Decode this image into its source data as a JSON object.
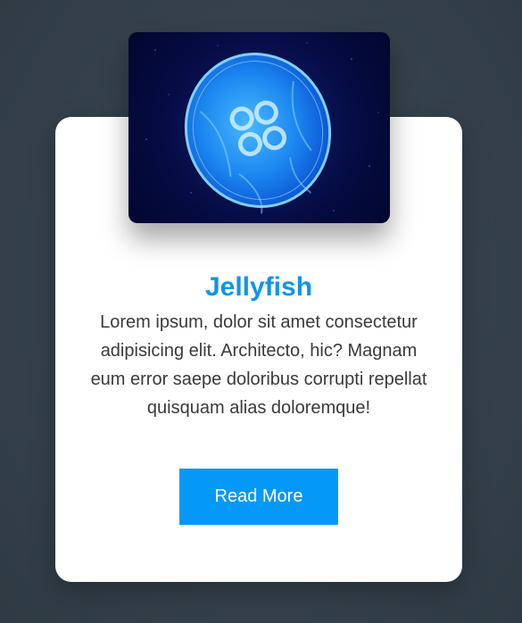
{
  "card": {
    "title": "Jellyfish",
    "description": "Lorem ipsum, dolor sit amet consectetur adipisicing elit. Architecto, hic? Magnam eum error saepe doloribus corrupti repellat quisquam alias doloremque!",
    "button_label": "Read More",
    "image_alt": "jellyfish-photo"
  },
  "colors": {
    "background": "#36414b",
    "card": "#ffffff",
    "title": "#0e94ec",
    "text": "#3a3a3a",
    "button": "#0499f7",
    "button_text": "#ffffff"
  }
}
